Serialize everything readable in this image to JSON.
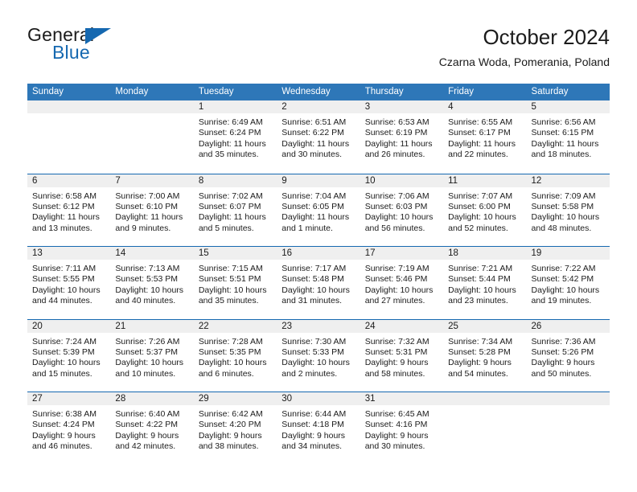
{
  "brand": {
    "name_top": "General",
    "name_bottom": "Blue",
    "flag_color": "#1568b0"
  },
  "header": {
    "title": "October 2024",
    "subtitle": "Czarna Woda, Pomerania, Poland"
  },
  "theme": {
    "header_bg": "#2e77b8",
    "row_divider": "#1568b0",
    "day_band_bg": "#efefef",
    "text": "#1b1b1b"
  },
  "weekdays": [
    "Sunday",
    "Monday",
    "Tuesday",
    "Wednesday",
    "Thursday",
    "Friday",
    "Saturday"
  ],
  "weeks": [
    [
      {
        "day": "",
        "lines": []
      },
      {
        "day": "",
        "lines": []
      },
      {
        "day": "1",
        "lines": [
          "Sunrise: 6:49 AM",
          "Sunset: 6:24 PM",
          "Daylight: 11 hours",
          "and 35 minutes."
        ]
      },
      {
        "day": "2",
        "lines": [
          "Sunrise: 6:51 AM",
          "Sunset: 6:22 PM",
          "Daylight: 11 hours",
          "and 30 minutes."
        ]
      },
      {
        "day": "3",
        "lines": [
          "Sunrise: 6:53 AM",
          "Sunset: 6:19 PM",
          "Daylight: 11 hours",
          "and 26 minutes."
        ]
      },
      {
        "day": "4",
        "lines": [
          "Sunrise: 6:55 AM",
          "Sunset: 6:17 PM",
          "Daylight: 11 hours",
          "and 22 minutes."
        ]
      },
      {
        "day": "5",
        "lines": [
          "Sunrise: 6:56 AM",
          "Sunset: 6:15 PM",
          "Daylight: 11 hours",
          "and 18 minutes."
        ]
      }
    ],
    [
      {
        "day": "6",
        "lines": [
          "Sunrise: 6:58 AM",
          "Sunset: 6:12 PM",
          "Daylight: 11 hours",
          "and 13 minutes."
        ]
      },
      {
        "day": "7",
        "lines": [
          "Sunrise: 7:00 AM",
          "Sunset: 6:10 PM",
          "Daylight: 11 hours",
          "and 9 minutes."
        ]
      },
      {
        "day": "8",
        "lines": [
          "Sunrise: 7:02 AM",
          "Sunset: 6:07 PM",
          "Daylight: 11 hours",
          "and 5 minutes."
        ]
      },
      {
        "day": "9",
        "lines": [
          "Sunrise: 7:04 AM",
          "Sunset: 6:05 PM",
          "Daylight: 11 hours",
          "and 1 minute."
        ]
      },
      {
        "day": "10",
        "lines": [
          "Sunrise: 7:06 AM",
          "Sunset: 6:03 PM",
          "Daylight: 10 hours",
          "and 56 minutes."
        ]
      },
      {
        "day": "11",
        "lines": [
          "Sunrise: 7:07 AM",
          "Sunset: 6:00 PM",
          "Daylight: 10 hours",
          "and 52 minutes."
        ]
      },
      {
        "day": "12",
        "lines": [
          "Sunrise: 7:09 AM",
          "Sunset: 5:58 PM",
          "Daylight: 10 hours",
          "and 48 minutes."
        ]
      }
    ],
    [
      {
        "day": "13",
        "lines": [
          "Sunrise: 7:11 AM",
          "Sunset: 5:55 PM",
          "Daylight: 10 hours",
          "and 44 minutes."
        ]
      },
      {
        "day": "14",
        "lines": [
          "Sunrise: 7:13 AM",
          "Sunset: 5:53 PM",
          "Daylight: 10 hours",
          "and 40 minutes."
        ]
      },
      {
        "day": "15",
        "lines": [
          "Sunrise: 7:15 AM",
          "Sunset: 5:51 PM",
          "Daylight: 10 hours",
          "and 35 minutes."
        ]
      },
      {
        "day": "16",
        "lines": [
          "Sunrise: 7:17 AM",
          "Sunset: 5:48 PM",
          "Daylight: 10 hours",
          "and 31 minutes."
        ]
      },
      {
        "day": "17",
        "lines": [
          "Sunrise: 7:19 AM",
          "Sunset: 5:46 PM",
          "Daylight: 10 hours",
          "and 27 minutes."
        ]
      },
      {
        "day": "18",
        "lines": [
          "Sunrise: 7:21 AM",
          "Sunset: 5:44 PM",
          "Daylight: 10 hours",
          "and 23 minutes."
        ]
      },
      {
        "day": "19",
        "lines": [
          "Sunrise: 7:22 AM",
          "Sunset: 5:42 PM",
          "Daylight: 10 hours",
          "and 19 minutes."
        ]
      }
    ],
    [
      {
        "day": "20",
        "lines": [
          "Sunrise: 7:24 AM",
          "Sunset: 5:39 PM",
          "Daylight: 10 hours",
          "and 15 minutes."
        ]
      },
      {
        "day": "21",
        "lines": [
          "Sunrise: 7:26 AM",
          "Sunset: 5:37 PM",
          "Daylight: 10 hours",
          "and 10 minutes."
        ]
      },
      {
        "day": "22",
        "lines": [
          "Sunrise: 7:28 AM",
          "Sunset: 5:35 PM",
          "Daylight: 10 hours",
          "and 6 minutes."
        ]
      },
      {
        "day": "23",
        "lines": [
          "Sunrise: 7:30 AM",
          "Sunset: 5:33 PM",
          "Daylight: 10 hours",
          "and 2 minutes."
        ]
      },
      {
        "day": "24",
        "lines": [
          "Sunrise: 7:32 AM",
          "Sunset: 5:31 PM",
          "Daylight: 9 hours",
          "and 58 minutes."
        ]
      },
      {
        "day": "25",
        "lines": [
          "Sunrise: 7:34 AM",
          "Sunset: 5:28 PM",
          "Daylight: 9 hours",
          "and 54 minutes."
        ]
      },
      {
        "day": "26",
        "lines": [
          "Sunrise: 7:36 AM",
          "Sunset: 5:26 PM",
          "Daylight: 9 hours",
          "and 50 minutes."
        ]
      }
    ],
    [
      {
        "day": "27",
        "lines": [
          "Sunrise: 6:38 AM",
          "Sunset: 4:24 PM",
          "Daylight: 9 hours",
          "and 46 minutes."
        ]
      },
      {
        "day": "28",
        "lines": [
          "Sunrise: 6:40 AM",
          "Sunset: 4:22 PM",
          "Daylight: 9 hours",
          "and 42 minutes."
        ]
      },
      {
        "day": "29",
        "lines": [
          "Sunrise: 6:42 AM",
          "Sunset: 4:20 PM",
          "Daylight: 9 hours",
          "and 38 minutes."
        ]
      },
      {
        "day": "30",
        "lines": [
          "Sunrise: 6:44 AM",
          "Sunset: 4:18 PM",
          "Daylight: 9 hours",
          "and 34 minutes."
        ]
      },
      {
        "day": "31",
        "lines": [
          "Sunrise: 6:45 AM",
          "Sunset: 4:16 PM",
          "Daylight: 9 hours",
          "and 30 minutes."
        ]
      },
      {
        "day": "",
        "lines": []
      },
      {
        "day": "",
        "lines": []
      }
    ]
  ]
}
